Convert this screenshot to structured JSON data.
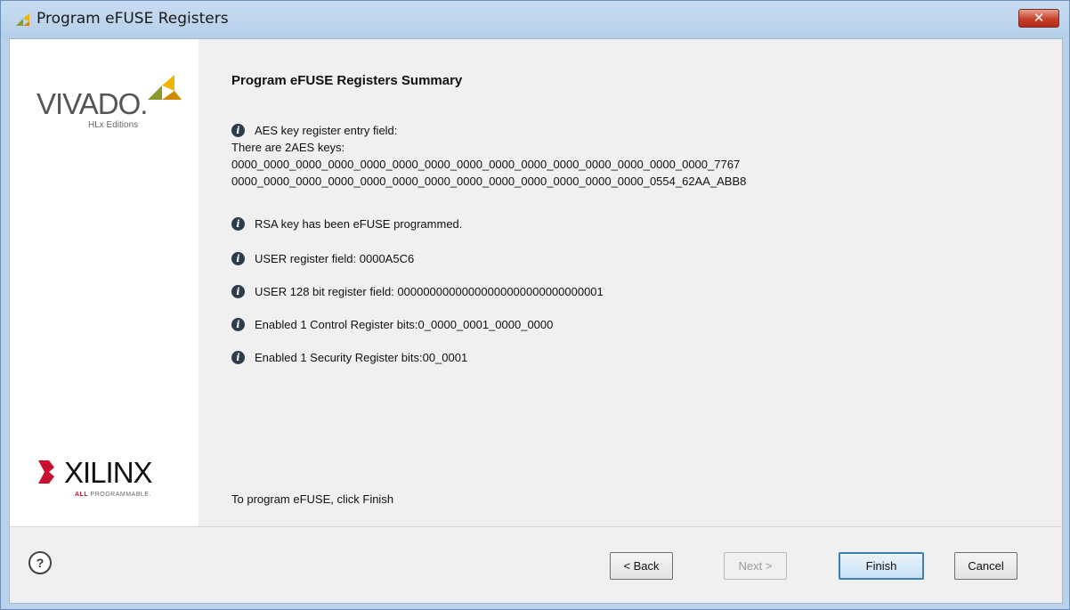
{
  "window": {
    "title": "Program eFUSE Registers",
    "close_label": "✕"
  },
  "branding": {
    "vivado_logo": "VIVADO.",
    "vivado_sub": "HLx Editions",
    "xilinx_logo": "XILINX",
    "xilinx_sub_prefix": "ALL",
    "xilinx_sub_rest": " PROGRAMMABLE."
  },
  "summary": {
    "heading": "Program eFUSE Registers Summary",
    "aes_title": "AES key register entry field:",
    "aes_count": "There are 2AES keys:",
    "aes_key_1": "0000_0000_0000_0000_0000_0000_0000_0000_0000_0000_0000_0000_0000_0000_0000_7767",
    "aes_key_2": "0000_0000_0000_0000_0000_0000_0000_0000_0000_0000_0000_0000_0000_0554_62AA_ABB8",
    "rsa": "RSA key has been eFUSE programmed.",
    "user_register": "USER register field: 0000A5C6",
    "user_128": "USER 128 bit register field: 00000000000000000000000000000001",
    "control_register": "Enabled 1 Control Register bits:0_0000_0001_0000_0000",
    "security_register": "Enabled 1 Security Register bits:00_0001",
    "footer": "To program eFUSE, click Finish"
  },
  "buttons": {
    "help": "?",
    "back": "< Back",
    "next": "Next >",
    "finish": "Finish",
    "cancel": "Cancel"
  },
  "icons": {
    "window": "vivado-leaf-icon",
    "info": "info-icon",
    "help": "help-icon"
  },
  "colors": {
    "titlebar": "#b9d1ea",
    "close": "#c7402a",
    "finish_border": "#3c7fb1",
    "info_icon": "#2d3c4d",
    "xilinx_red": "#c8102e"
  }
}
